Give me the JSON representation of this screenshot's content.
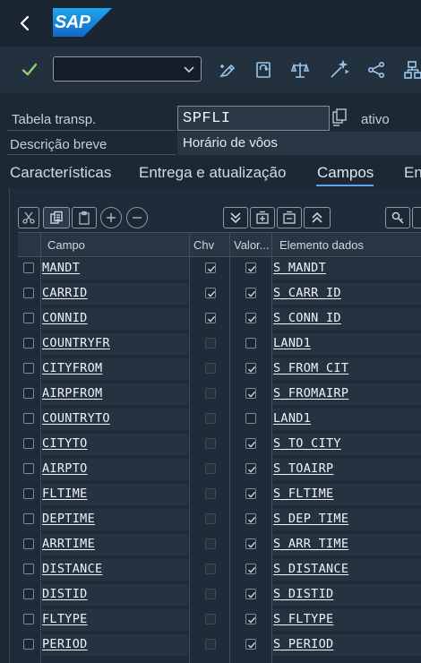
{
  "header": {
    "logo_text": "SAP",
    "back_icon": "chevron-left-icon"
  },
  "toolbar": {
    "command_value": "",
    "icons": [
      "checkmark-icon",
      "display-change-icon",
      "activate-icon",
      "check-object-icon",
      "balance-icon",
      "magic-wand-icon",
      "where-used-icon",
      "hierarchy-icon"
    ]
  },
  "fields": {
    "table_label": "Tabela transp.",
    "table_value": "SPFLI",
    "status": "ativo",
    "desc_label": "Descrição breve",
    "desc_value": "Horário de vôos"
  },
  "tabs": [
    {
      "label": "Características"
    },
    {
      "label": "Entrega e atualização"
    },
    {
      "label": "Campos",
      "active": true
    },
    {
      "label": "En"
    }
  ],
  "grid_toolbar": [
    "cut-icon",
    "copy-icon",
    "paste-icon",
    "insert-row-icon",
    "delete-row-icon",
    "expand-all-icon",
    "insert-structure-icon",
    "collapse-icon",
    "scroll-up-icon",
    "search-icon"
  ],
  "columns": {
    "campo": "Campo",
    "chv": "Chv",
    "valor": "Valor...",
    "elemento": "Elemento dados"
  },
  "rows": [
    {
      "campo": "MANDT",
      "key": true,
      "val": true,
      "de": "S_MANDT"
    },
    {
      "campo": "CARRID",
      "key": true,
      "val": true,
      "de": "S_CARR_ID"
    },
    {
      "campo": "CONNID",
      "key": true,
      "val": true,
      "de": "S_CONN_ID"
    },
    {
      "campo": "COUNTRYFR",
      "key": false,
      "val": false,
      "de": "LAND1"
    },
    {
      "campo": "CITYFROM",
      "key": false,
      "val": true,
      "de": "S_FROM_CIT"
    },
    {
      "campo": "AIRPFROM",
      "key": false,
      "val": true,
      "de": "S_FROMAIRP"
    },
    {
      "campo": "COUNTRYTO",
      "key": false,
      "val": false,
      "de": "LAND1"
    },
    {
      "campo": "CITYTO",
      "key": false,
      "val": true,
      "de": "S_TO_CITY"
    },
    {
      "campo": "AIRPTO",
      "key": false,
      "val": true,
      "de": "S_TOAIRP"
    },
    {
      "campo": "FLTIME",
      "key": false,
      "val": true,
      "de": "S_FLTIME"
    },
    {
      "campo": "DEPTIME",
      "key": false,
      "val": true,
      "de": "S_DEP_TIME"
    },
    {
      "campo": "ARRTIME",
      "key": false,
      "val": true,
      "de": "S_ARR_TIME"
    },
    {
      "campo": "DISTANCE",
      "key": false,
      "val": true,
      "de": "S_DISTANCE"
    },
    {
      "campo": "DISTID",
      "key": false,
      "val": true,
      "de": "S_DISTID"
    },
    {
      "campo": "FLTYPE",
      "key": false,
      "val": true,
      "de": "S_FLTYPE"
    },
    {
      "campo": "PERIOD",
      "key": false,
      "val": true,
      "de": "S_PERIOD"
    }
  ],
  "colors": {
    "accent": "#5aa6e8",
    "check": "#c8d2dc",
    "sap_blue": "#1b7fe0"
  }
}
